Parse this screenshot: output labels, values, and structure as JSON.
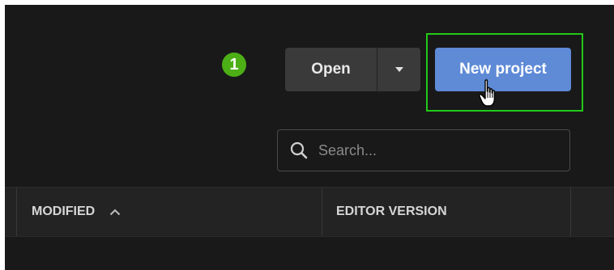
{
  "annotation": {
    "step_number": "1",
    "badge_color": "#4caf16",
    "highlight_color": "#22c919"
  },
  "toolbar": {
    "open_label": "Open",
    "open_dropdown_icon": "caret-down-icon",
    "new_project_label": "New project",
    "new_project_color": "#5e8ad6",
    "cursor_icon": "hand-pointer-icon"
  },
  "search": {
    "icon": "search-icon",
    "value": "",
    "placeholder": "Search..."
  },
  "table": {
    "columns": [
      {
        "label": "MODIFIED",
        "sort": "ascending",
        "sort_icon": "chevron-up-icon"
      },
      {
        "label": "EDITOR VERSION"
      }
    ]
  },
  "theme": {
    "background": "#191919",
    "header_background": "#232323"
  }
}
